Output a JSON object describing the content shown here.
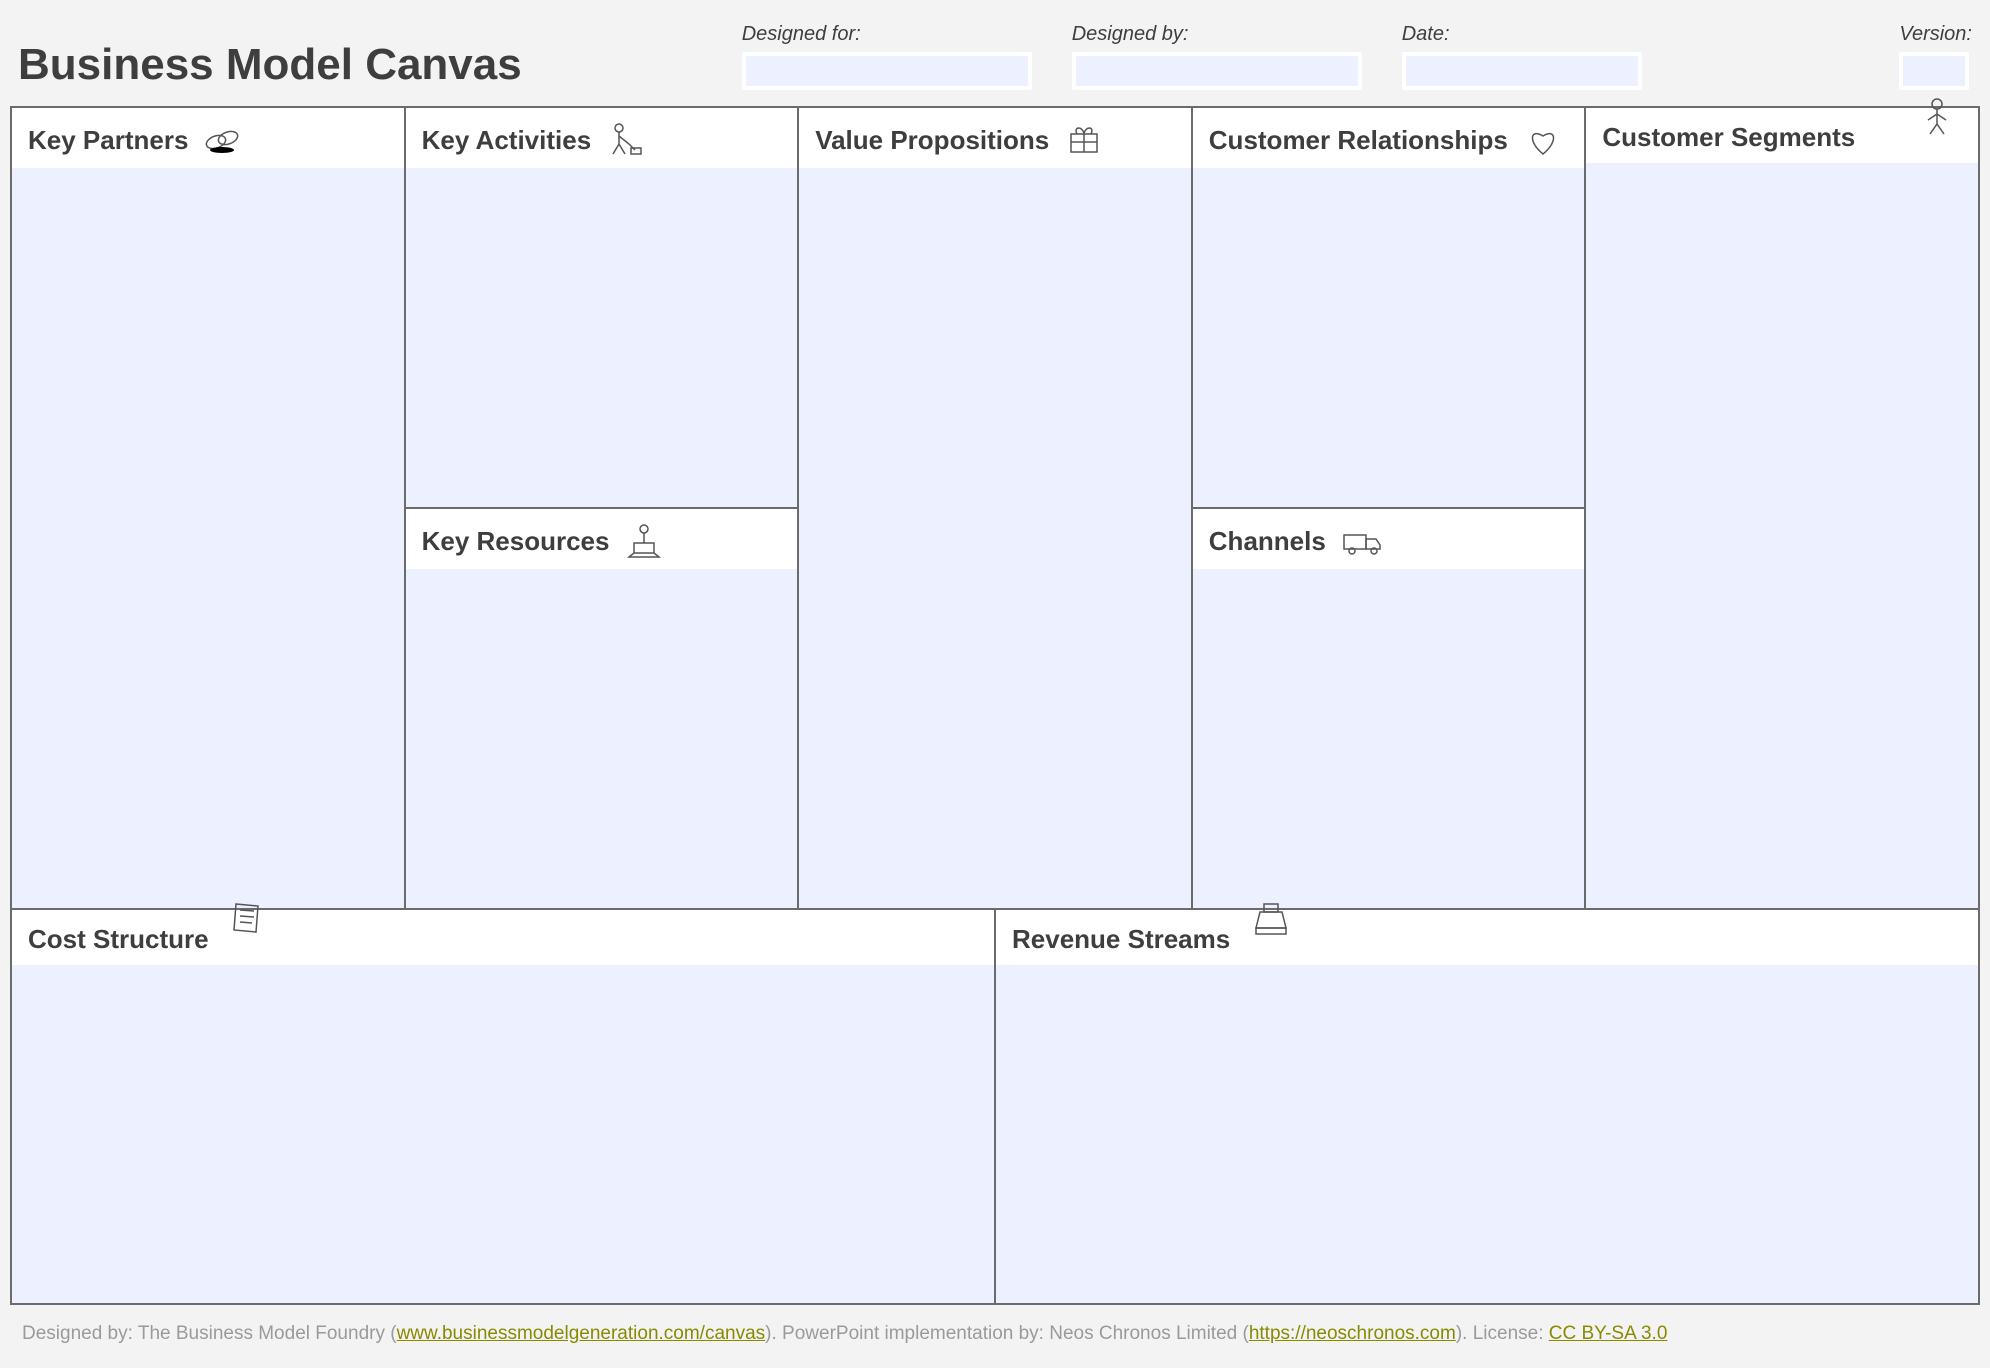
{
  "title": "Business Model Canvas",
  "meta": {
    "designed_for_label": "Designed for:",
    "designed_for_value": "",
    "designed_by_label": "Designed by:",
    "designed_by_value": "",
    "date_label": "Date:",
    "date_value": "",
    "version_label": "Version:",
    "version_value": ""
  },
  "cells": {
    "key_partners": {
      "title": "Key Partners",
      "content": ""
    },
    "key_activities": {
      "title": "Key Activities",
      "content": ""
    },
    "key_resources": {
      "title": "Key Resources",
      "content": ""
    },
    "value_propositions": {
      "title": "Value Propositions",
      "content": ""
    },
    "customer_relationships": {
      "title": "Customer Relationships",
      "content": ""
    },
    "channels": {
      "title": "Channels",
      "content": ""
    },
    "customer_segments": {
      "title": "Customer Segments",
      "content": ""
    },
    "cost_structure": {
      "title": "Cost Structure",
      "content": ""
    },
    "revenue_streams": {
      "title": "Revenue Streams",
      "content": ""
    }
  },
  "footnote": {
    "prefix": "Designed by: The Business Model Foundry (",
    "link1_text": "www.businessmodelgeneration.com/canvas",
    "mid1": "). PowerPoint implementation by: Neos Chronos Limited (",
    "link2_text": "https://neoschronos.com",
    "mid2": "). License: ",
    "link3_text": "CC BY-SA 3.0"
  }
}
